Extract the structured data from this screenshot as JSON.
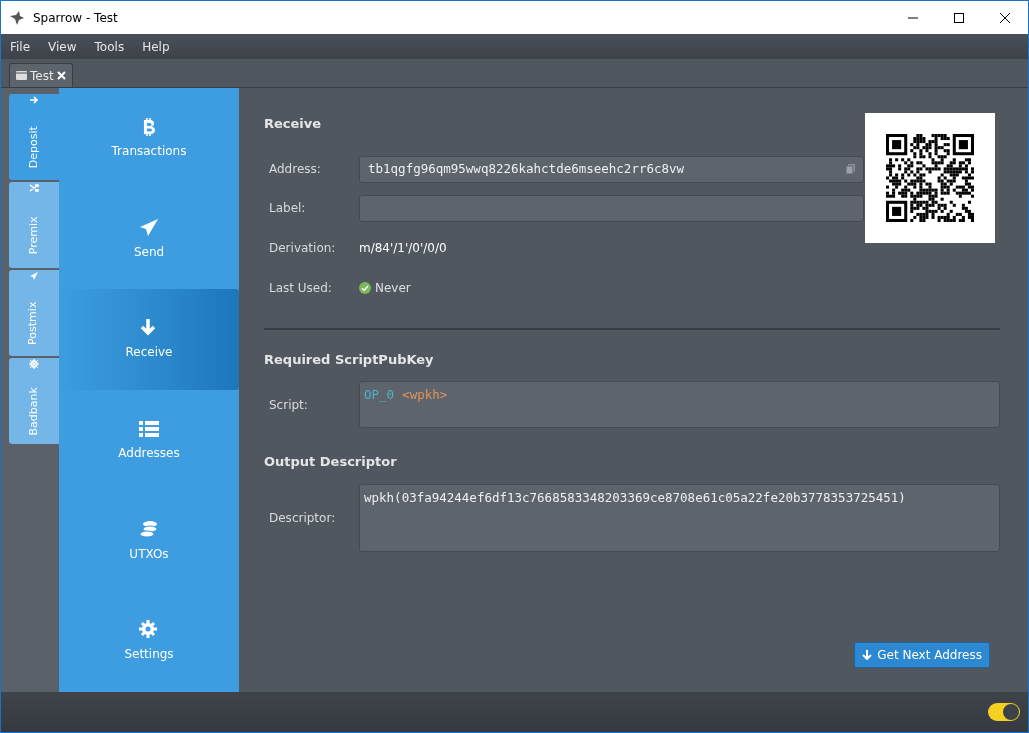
{
  "window": {
    "title": "Sparrow - Test"
  },
  "menu": [
    "File",
    "View",
    "Tools",
    "Help"
  ],
  "doc_tabs": [
    {
      "label": "Test",
      "selected": true
    }
  ],
  "account_tabs": [
    {
      "label": "Deposit",
      "selected": true
    },
    {
      "label": "Premix",
      "selected": false
    },
    {
      "label": "Postmix",
      "selected": false
    },
    {
      "label": "Badbank",
      "selected": false
    }
  ],
  "nav": [
    {
      "label": "Transactions",
      "selected": false
    },
    {
      "label": "Send",
      "selected": false
    },
    {
      "label": "Receive",
      "selected": true
    },
    {
      "label": "Addresses",
      "selected": false
    },
    {
      "label": "UTXOs",
      "selected": false
    },
    {
      "label": "Settings",
      "selected": false
    }
  ],
  "receive": {
    "title": "Receive",
    "address_label": "Address:",
    "address": "tb1qgfg96qm95wwq8226kahctde6mseehc2rr6c8vw",
    "label_label": "Label:",
    "derivation_label": "Derivation:",
    "derivation": "m/84'/1'/0'/0/0",
    "last_used_label": "Last Used:",
    "last_used": "Never"
  },
  "script_section": {
    "title": "Required ScriptPubKey",
    "label": "Script:",
    "tokens": [
      {
        "text": "OP_0",
        "kind": "opcode"
      },
      {
        "text": "<wpkh>",
        "kind": "data"
      }
    ]
  },
  "descriptor_section": {
    "title": "Output Descriptor",
    "label": "Descriptor:",
    "value": "wpkh(03fa94244ef6df13c7668583348203369ce8708e61c05a22fe20b3778353725451)"
  },
  "next_button": "Get Next Address",
  "status_bar": {
    "toggle_on": true
  }
}
